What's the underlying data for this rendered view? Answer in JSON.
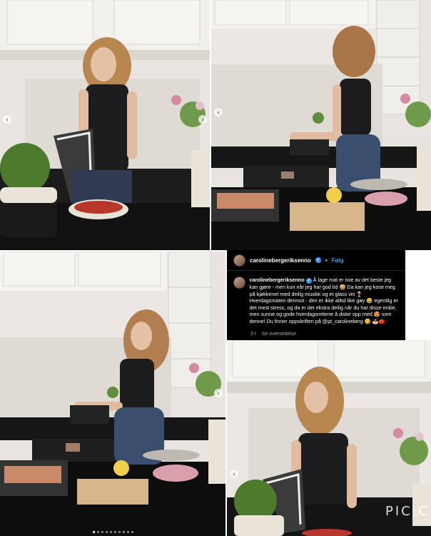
{
  "post": {
    "username": "carolinebergeriksenno",
    "verified_mark": "✓",
    "separator": "•",
    "follow_label": "Følg",
    "caption": "Å lage mat er noe av det beste jeg kan gjøre - men kun når jeg har god tid 😅 Da kan jeg kose meg på kjøkkenet med deilig musikk og et glass vin 🍷 Hverdagsmaten derimot - den er ikke alltid like gøy 😂 egentlig er det mest stress, og da er det ekstra deilig når du har disse enkle, men sunne og gode hverdagsrettene å diske opp med 😍 som denne! Du finner oppskriften på @pt_carolineberg 😋 🍝🍅",
    "time_ago": "3 t",
    "translate_label": "Se oversettelse"
  },
  "carousel": {
    "prev_symbol": "‹",
    "next_symbol": "›",
    "dot_count": 10,
    "active_dot": 0
  },
  "watermark": "PIC·C",
  "colors": {
    "instagram_blue": "#3897f0",
    "overlay_bg": "#000000",
    "secondary_text": "#a8a8a8"
  }
}
